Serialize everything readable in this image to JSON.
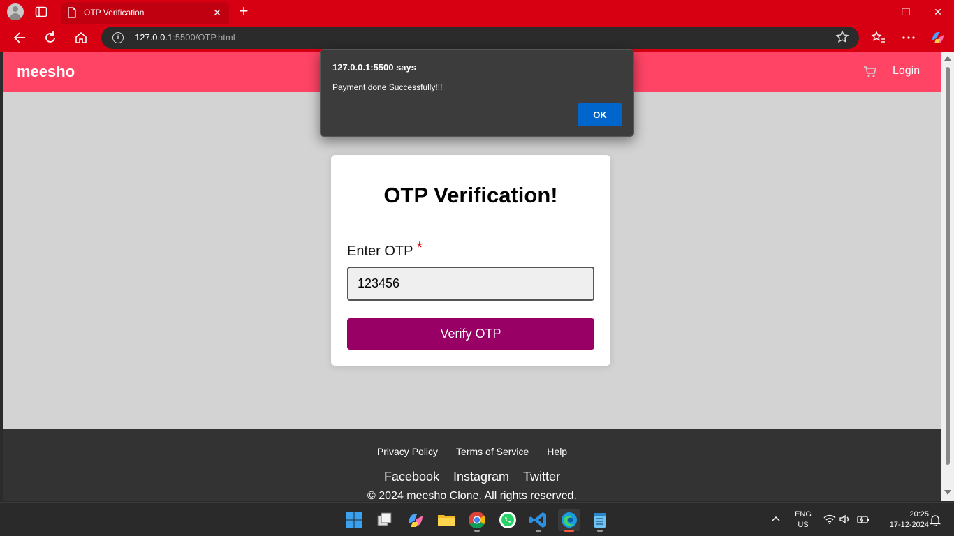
{
  "browser": {
    "tab_title": "OTP Verification",
    "url_host": "127.0.0.1",
    "url_rest": ":5500/OTP.html"
  },
  "page": {
    "brand": "meesho",
    "login_label": "Login",
    "card_title": "OTP Verification!",
    "otp_label": "Enter OTP",
    "required_mark": "*",
    "otp_value": "123456",
    "verify_label": "Verify OTP"
  },
  "footer": {
    "links": [
      "Privacy Policy",
      "Terms of Service",
      "Help"
    ],
    "social": [
      "Facebook",
      "Instagram",
      "Twitter"
    ],
    "copyright": "© 2024 meesho Clone. All rights reserved."
  },
  "alert": {
    "origin": "127.0.0.1:5500 says",
    "message": "Payment done Successfully!!!",
    "ok_label": "OK"
  },
  "taskbar": {
    "lang_line1": "ENG",
    "lang_line2": "US",
    "time": "20:25",
    "date": "17-12-2024"
  },
  "colors": {
    "browser_frame": "#d60012",
    "navbar": "#ff4466",
    "verify_button": "#990066",
    "alert_ok": "#0066cc",
    "footer": "#333333"
  }
}
